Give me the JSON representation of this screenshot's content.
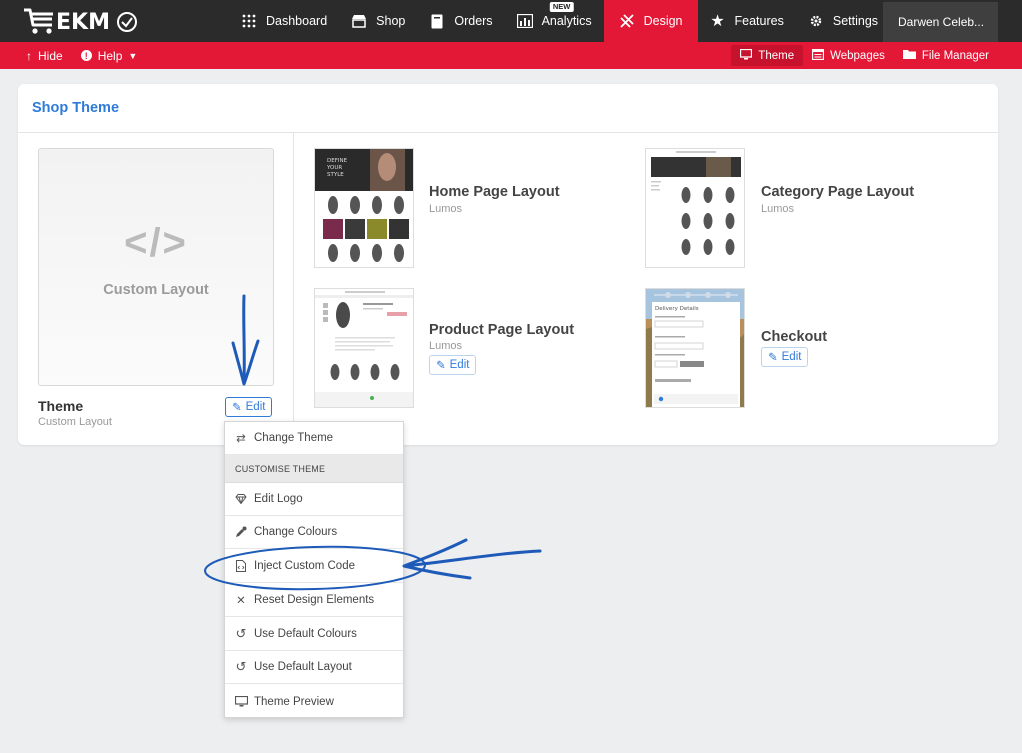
{
  "app": {
    "logo_text": "EKM"
  },
  "nav": {
    "items": [
      {
        "label": "Dashboard",
        "icon": "grid-icon"
      },
      {
        "label": "Shop",
        "icon": "shop-icon"
      },
      {
        "label": "Orders",
        "icon": "orders-icon"
      },
      {
        "label": "Analytics",
        "icon": "analytics-icon",
        "badge": "NEW"
      },
      {
        "label": "Design",
        "icon": "design-icon",
        "active": true
      },
      {
        "label": "Features",
        "icon": "star-icon"
      },
      {
        "label": "Settings",
        "icon": "gear-icon"
      }
    ],
    "account": "Darwen Celeb..."
  },
  "subbar": {
    "hide": "Hide",
    "help": "Help",
    "theme": "Theme",
    "webpages": "Webpages",
    "file_manager": "File Manager"
  },
  "card": {
    "title": "Shop Theme",
    "custom_layout_code": "</>",
    "custom_layout_label": "Custom Layout",
    "theme_name": "Theme",
    "theme_sub": "Custom Layout",
    "edit_label": "Edit"
  },
  "layouts": [
    {
      "title": "Home Page Layout",
      "sub": "Lumos"
    },
    {
      "title": "Category Page Layout",
      "sub": "Lumos"
    },
    {
      "title": "Product Page Layout",
      "sub": "Lumos",
      "edit": "Edit"
    },
    {
      "title": "Checkout",
      "edit": "Edit"
    }
  ],
  "thumbs": {
    "home_banner": "DEFINE YOUR STYLE",
    "checkout_heading": "Delivery Details"
  },
  "dropdown": {
    "change_theme": "Change Theme",
    "header": "CUSTOMISE THEME",
    "edit_logo": "Edit Logo",
    "change_colours": "Change Colours",
    "inject_code": "Inject Custom Code",
    "reset_design": "Reset Design Elements",
    "default_colours": "Use Default Colours",
    "default_layout": "Use Default Layout",
    "theme_preview": "Theme Preview"
  },
  "colors": {
    "brand_red": "#e31837",
    "nav_dark": "#2b2b2b",
    "link_blue": "#2f7bd9",
    "annotation_blue": "#1e5bb8"
  }
}
